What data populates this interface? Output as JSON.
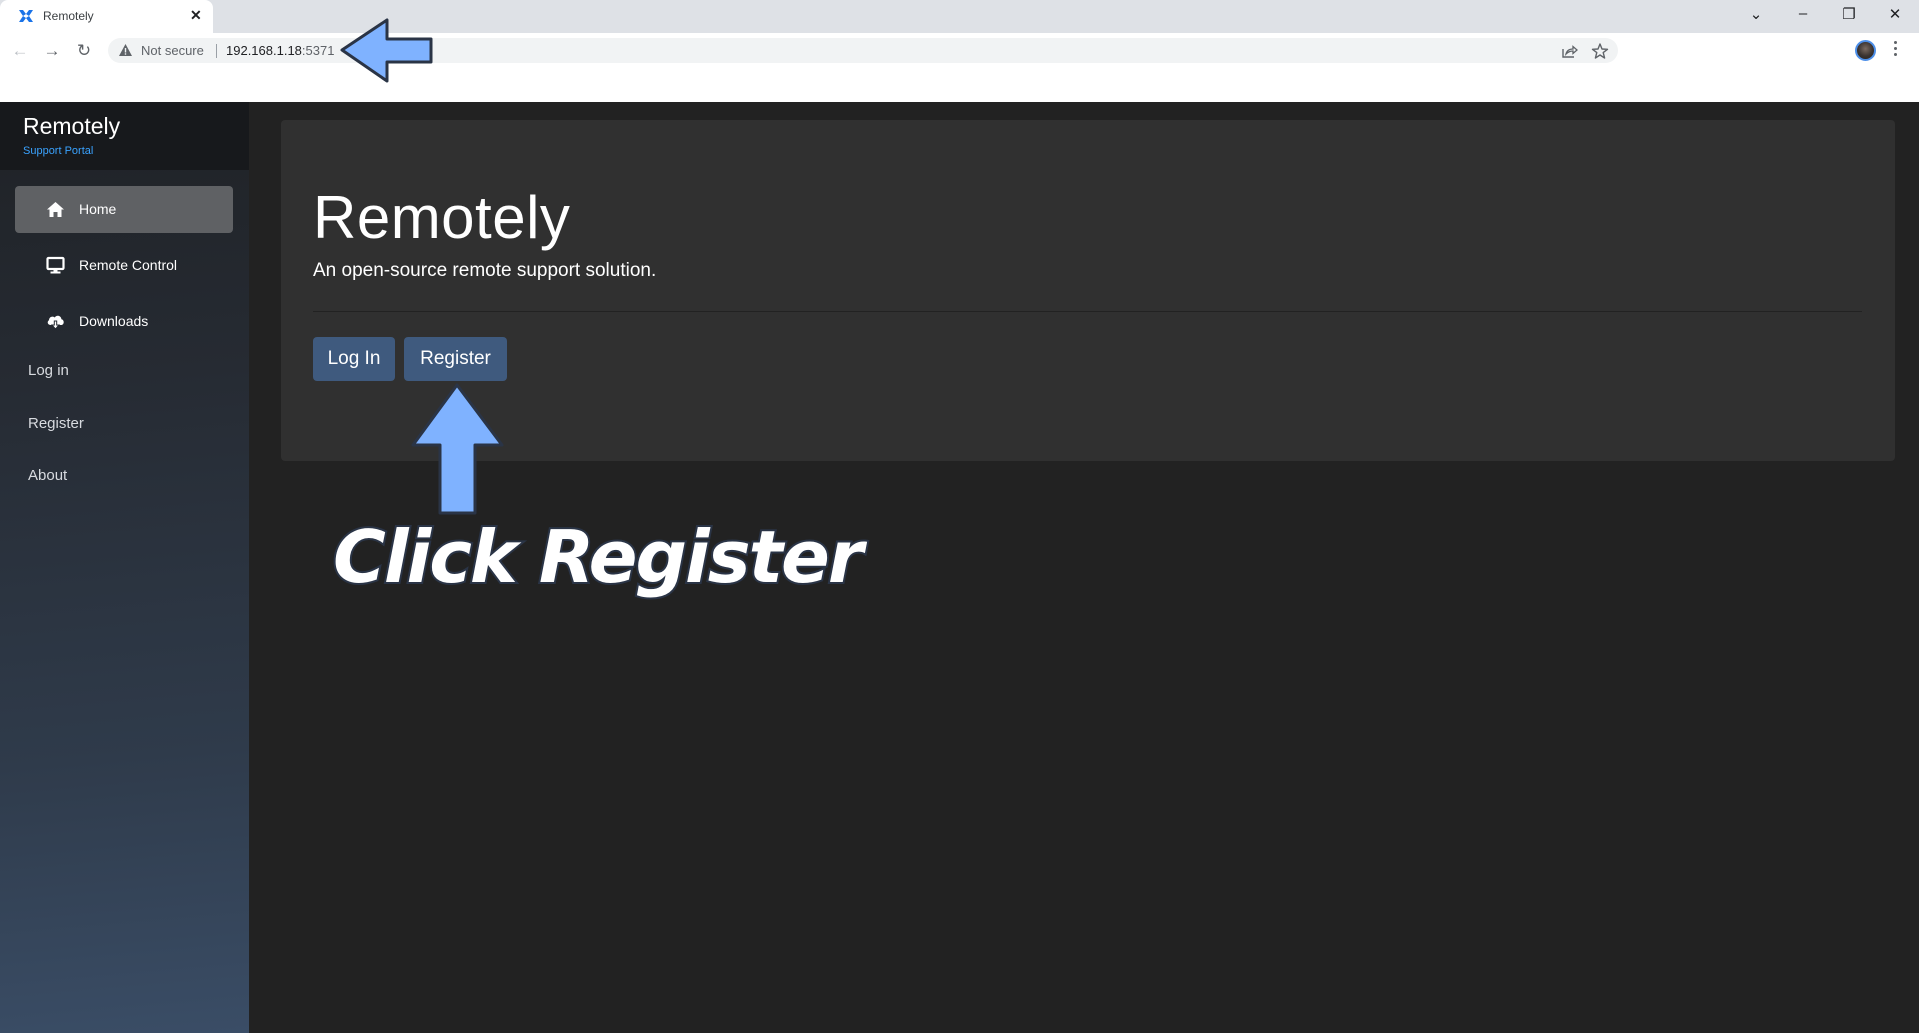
{
  "browser": {
    "tab": {
      "title": "Remotely",
      "favicon": "remotely-logo-icon",
      "close_icon": "close-icon"
    },
    "window_controls": [
      "tab-search-icon",
      "minimize-icon",
      "restore-icon",
      "close-icon"
    ],
    "nav": {
      "back_icon": "arrow-left-icon",
      "forward_icon": "arrow-right-icon",
      "reload_icon": "reload-icon"
    },
    "omnibox": {
      "security_icon": "warning-triangle-icon",
      "security_label": "Not secure",
      "url_host": "192.168.1.18",
      "url_port": ":5371",
      "share_icon": "share-icon",
      "bookmark_icon": "star-icon"
    },
    "profile_icon": "avatar",
    "menu_icon": "kebab-menu-icon"
  },
  "sidebar": {
    "brand": "Remotely",
    "tagline": "Support Portal",
    "nav_items": [
      {
        "label": "Home",
        "icon": "home-icon",
        "active": true
      },
      {
        "label": "Remote Control",
        "icon": "monitor-icon",
        "active": false
      },
      {
        "label": "Downloads",
        "icon": "cloud-download-icon",
        "active": false
      }
    ],
    "links": [
      {
        "label": "Log in"
      },
      {
        "label": "Register"
      },
      {
        "label": "About"
      }
    ]
  },
  "main": {
    "title": "Remotely",
    "subtitle": "An open-source remote support solution.",
    "buttons": {
      "login": "Log In",
      "register": "Register"
    }
  },
  "annotations": {
    "instruction": "Click Register",
    "arrow_color": "#7fb2ff",
    "arrow_outline": "#2a3446"
  },
  "colors": {
    "accent_button": "#3f5a7e",
    "tagline": "#3aa3ff",
    "card_bg": "#303030",
    "page_bg": "#222222"
  }
}
